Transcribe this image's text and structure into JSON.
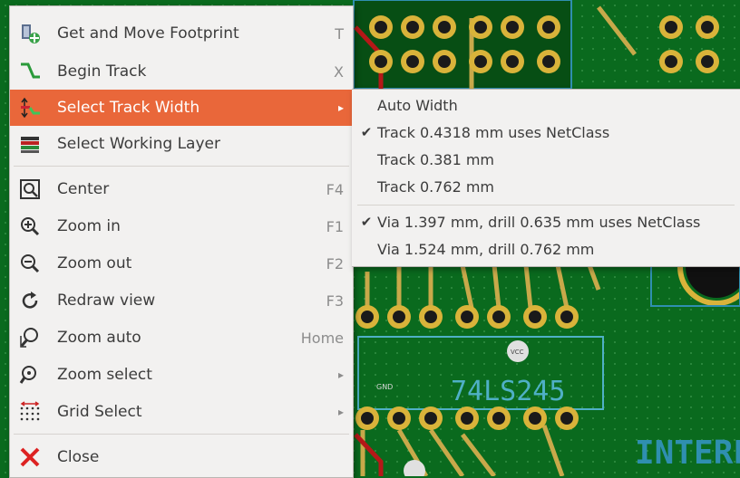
{
  "board": {
    "chip_label": "74LS245",
    "chip_label_color": "#4fb0c6",
    "corner_text": "INTERF",
    "vcc_label": "VCC",
    "gnd_label": "GND",
    "colors": {
      "background": "#0a6a1e",
      "track": "#c8a94a",
      "pad": "#d9b33a",
      "track_red": "#b51818"
    }
  },
  "context_menu": {
    "items": [
      {
        "label": "Get and Move Footprint",
        "shortcut": "T",
        "icon": "footprint-icon"
      },
      {
        "label": "Begin Track",
        "shortcut": "X",
        "icon": "track-icon"
      },
      {
        "label": "Select Track Width",
        "shortcut": "",
        "icon": "track-width-icon",
        "submenu": true,
        "highlighted": true
      },
      {
        "label": "Select Working Layer",
        "shortcut": "",
        "icon": "layers-icon"
      },
      {
        "label": "Center",
        "shortcut": "F4",
        "icon": "center-icon"
      },
      {
        "label": "Zoom in",
        "shortcut": "F1",
        "icon": "zoom-in-icon"
      },
      {
        "label": "Zoom out",
        "shortcut": "F2",
        "icon": "zoom-out-icon"
      },
      {
        "label": "Redraw view",
        "shortcut": "F3",
        "icon": "redraw-icon"
      },
      {
        "label": "Zoom auto",
        "shortcut": "Home",
        "icon": "zoom-auto-icon"
      },
      {
        "label": "Zoom select",
        "shortcut": "",
        "icon": "zoom-select-icon",
        "submenu": true
      },
      {
        "label": "Grid Select",
        "shortcut": "",
        "icon": "grid-icon",
        "submenu": true
      },
      {
        "label": "Close",
        "shortcut": "",
        "icon": "close-icon"
      }
    ],
    "highlight_color": "#e9673a"
  },
  "submenu": {
    "items": [
      {
        "label": "Auto Width",
        "checked": false
      },
      {
        "label": "Track 0.4318 mm uses NetClass",
        "checked": true
      },
      {
        "label": "Track 0.381 mm",
        "checked": false
      },
      {
        "label": "Track 0.762 mm",
        "checked": false
      },
      {
        "label": "Via 1.397 mm, drill 0.635 mm uses NetClass",
        "checked": true
      },
      {
        "label": "Via 1.524 mm, drill 0.762 mm",
        "checked": false
      }
    ],
    "check_glyph": "✔"
  }
}
